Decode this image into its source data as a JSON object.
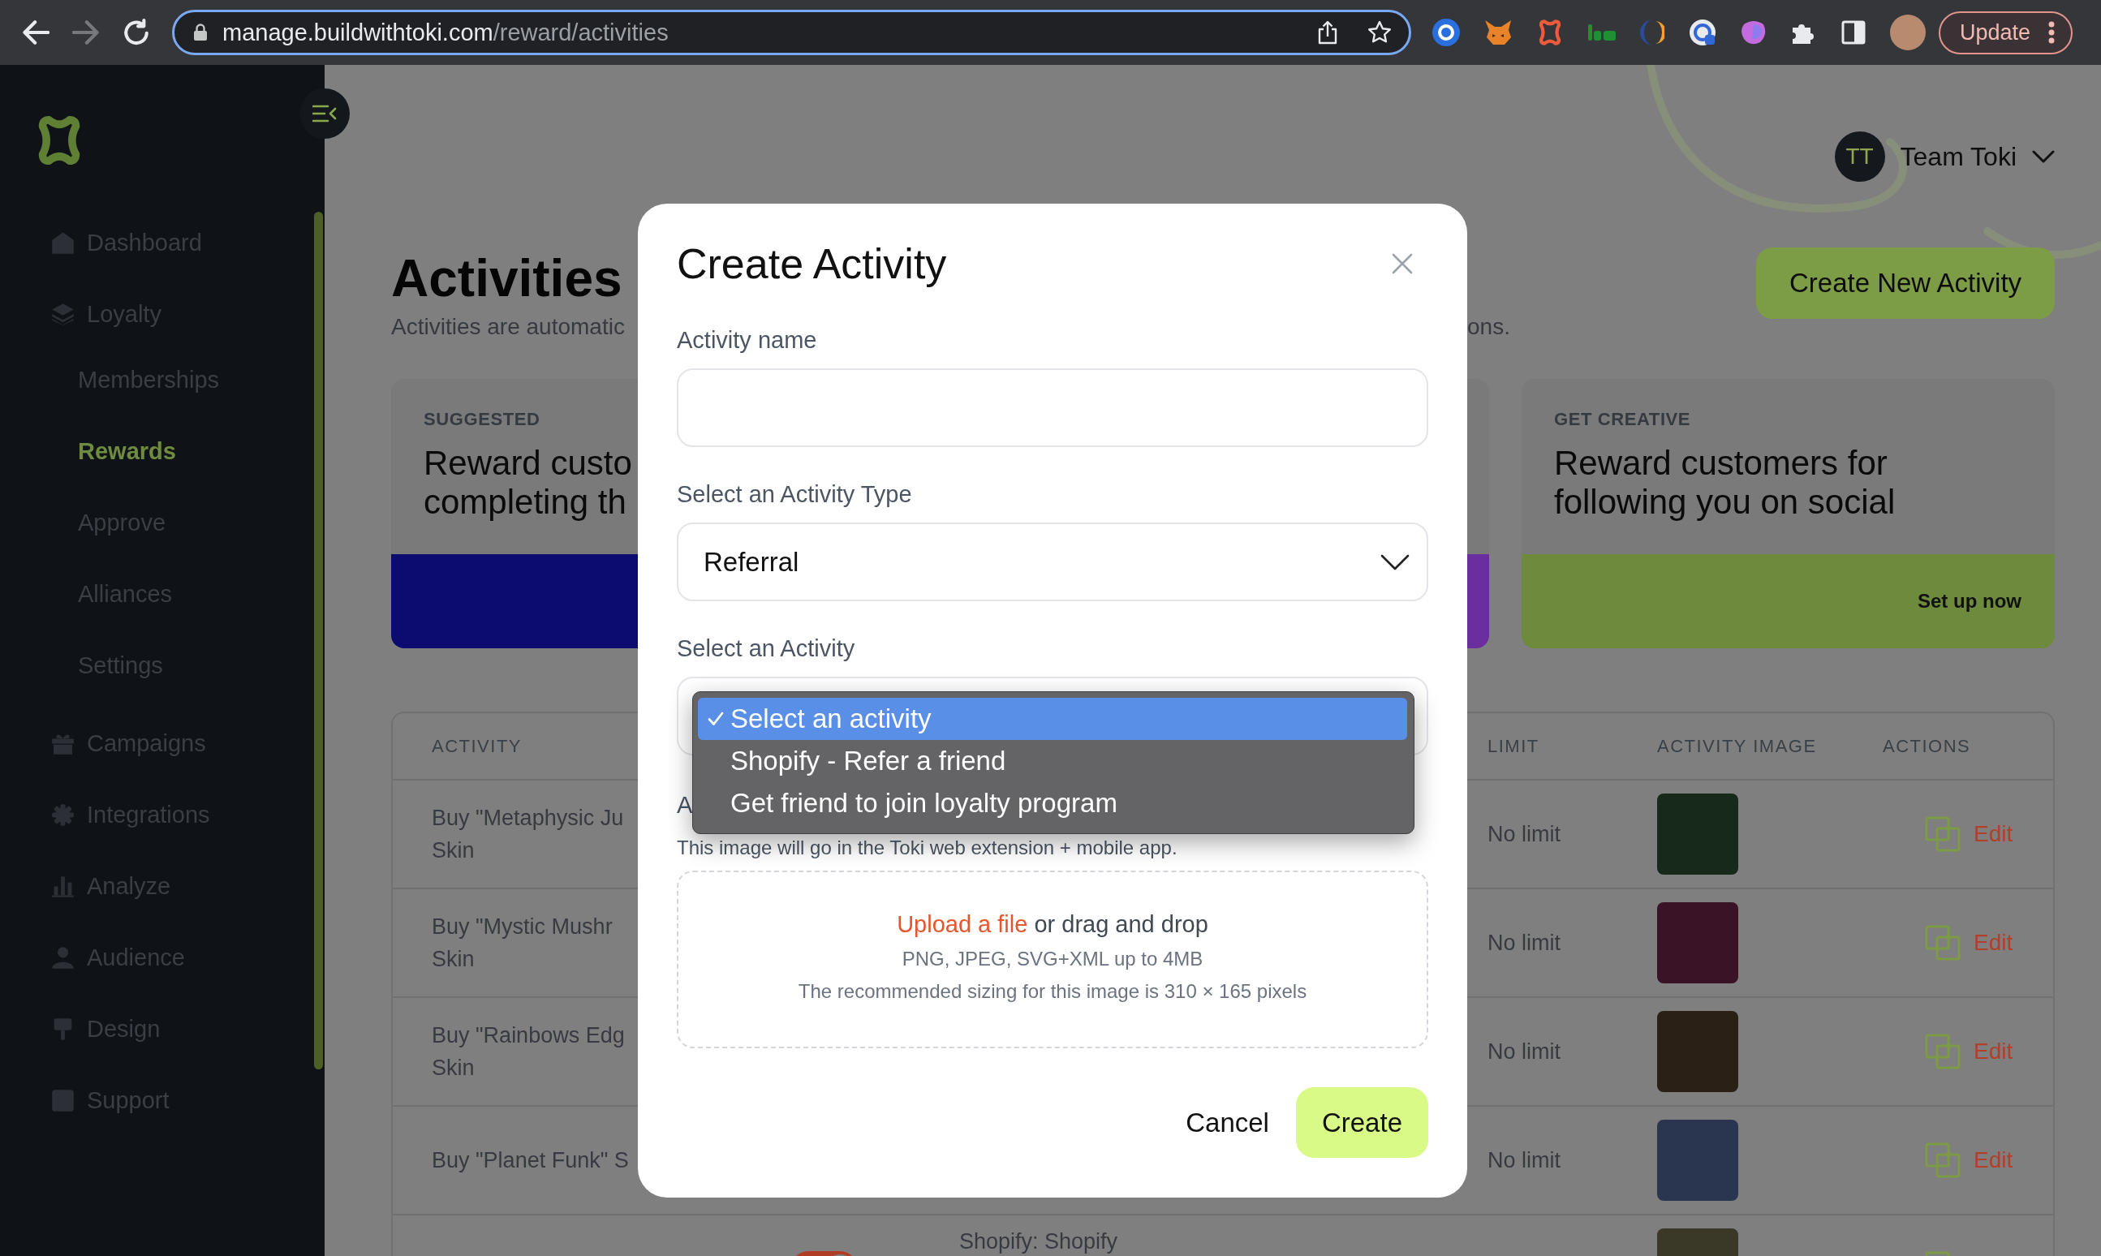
{
  "browser": {
    "nav": [
      {
        "kind": "back",
        "disabled": false
      },
      {
        "kind": "forward",
        "disabled": true
      },
      {
        "kind": "reload",
        "disabled": false
      }
    ],
    "url_host": "manage.buildwithtoki.com",
    "url_path": "/reward/activities",
    "update_label": "Update"
  },
  "sidebar": {
    "items": [
      {
        "label": "Dashboard",
        "selected": false
      },
      {
        "label": "Loyalty",
        "selected": false,
        "children": [
          {
            "label": "Memberships",
            "selected": false
          },
          {
            "label": "Rewards",
            "selected": true
          },
          {
            "label": "Approve",
            "selected": false
          },
          {
            "label": "Alliances",
            "selected": false
          },
          {
            "label": "Settings",
            "selected": false
          }
        ]
      },
      {
        "label": "Campaigns",
        "selected": false
      },
      {
        "label": "Integrations",
        "selected": false
      },
      {
        "label": "Analyze",
        "selected": false
      },
      {
        "label": "Audience",
        "selected": false
      },
      {
        "label": "Design",
        "selected": false
      },
      {
        "label": "Support",
        "selected": false
      }
    ]
  },
  "header": {
    "initials": "TT",
    "name": "Team Toki"
  },
  "page": {
    "title": "Activities",
    "subtitle": "Activities are automatic",
    "subtitle_end": "ons.",
    "create_button": "Create New Activity"
  },
  "cards": [
    {
      "eyebrow": "SUGGESTED",
      "title_lines": [
        "Reward custo",
        "completing th"
      ],
      "color": "#0c0b70"
    },
    {
      "color": "#6a2e9e"
    },
    {
      "eyebrow": "GET CREATIVE",
      "title_lines": [
        "Reward customers for",
        "following you on social"
      ],
      "action": "Set up now",
      "color": "#6e8b3d"
    }
  ],
  "table": {
    "headers": {
      "activity": "ACTIVITY",
      "limit": "LIMIT",
      "activity_image": "ACTIVITY IMAGE",
      "actions": "ACTIONS"
    },
    "rows": [
      {
        "activity": [
          "Buy \"Metaphysic Ju",
          "Skin"
        ],
        "limit": "No limit",
        "action": "Edit"
      },
      {
        "activity": [
          "Buy \"Mystic Mushr",
          "Skin"
        ],
        "limit": "No limit",
        "action": "Edit"
      },
      {
        "activity": [
          "Buy \"Rainbows Edg",
          "Skin"
        ],
        "limit": "No limit",
        "action": "Edit"
      },
      {
        "activity": [
          "Buy \"Planet Funk\" S"
        ],
        "limit": "No limit",
        "action": "Edit"
      },
      {
        "column_2": {
          "on": true
        },
        "column_3": "Shopify: Shopify"
      }
    ]
  },
  "modal": {
    "title": "Create Activity",
    "fields": [
      {
        "kind": "text",
        "label": "Activity name"
      },
      {
        "kind": "select",
        "label": "Select an Activity Type",
        "value": "Referral",
        "open": false
      },
      {
        "kind": "select",
        "label": "Select an Activity",
        "open": true,
        "options": [
          {
            "label": "Select an activity",
            "selected": true
          },
          {
            "label": "Shopify - Refer a friend",
            "selected": false
          },
          {
            "label": "Get friend to join loyalty program",
            "selected": false
          }
        ]
      },
      {
        "kind": "upload",
        "label": "A",
        "help": "This image will go in the Toki web extension + mobile app.",
        "link": "Upload a file",
        "prompt": "or drag and drop",
        "formats": "PNG, JPEG, SVG+XML up to 4MB",
        "sizing": "The recommended sizing for this image is 310 × 165 pixels"
      }
    ],
    "buttons": [
      {
        "kind": "secondary",
        "label": "Cancel"
      },
      {
        "kind": "primary",
        "label": "Create"
      }
    ]
  }
}
